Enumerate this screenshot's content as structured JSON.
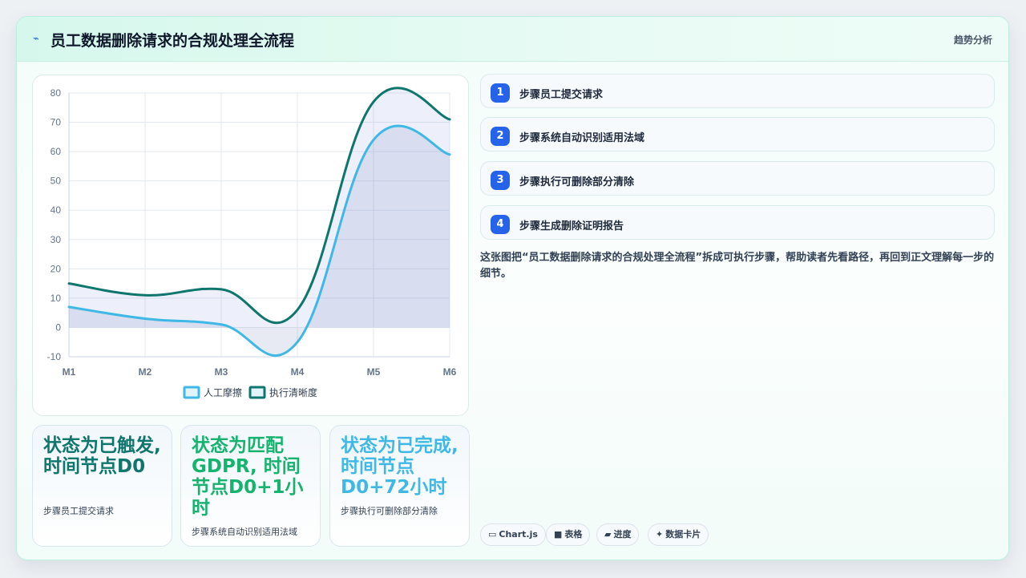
{
  "header": {
    "icon": "bolt-icon",
    "title": "员工数据删除请求的合规处理全流程",
    "tag": "趋势分析"
  },
  "chart_data": {
    "type": "area",
    "categories": [
      "M1",
      "M2",
      "M3",
      "M4",
      "M5",
      "M6"
    ],
    "ylim": [
      -10,
      80
    ],
    "yticks": [
      -10,
      0,
      10,
      20,
      30,
      40,
      50,
      60,
      70,
      80
    ],
    "grid": true,
    "legend_position": "bottom",
    "series": [
      {
        "name": "人工摩擦",
        "values": [
          7,
          3,
          1,
          -5,
          64,
          59
        ],
        "color": "#3fb8e6"
      },
      {
        "name": "执行清晰度",
        "values": [
          15,
          11,
          13,
          6,
          77,
          71
        ],
        "color": "#0f766e"
      }
    ]
  },
  "cards": [
    {
      "value": "状态为已触发, 时间节点D0",
      "label": "步骤员工提交请求",
      "color": "#0f766e"
    },
    {
      "value": "状态为匹配GDPR, 时间节点D0+1小时",
      "label": "步骤系统自动识别适用法域",
      "color": "#16b36e"
    },
    {
      "value": "状态为已完成, 时间节点D0+72小时",
      "label": "步骤执行可删除部分清除",
      "color": "#3fb8e6"
    }
  ],
  "steps": [
    {
      "num": "1",
      "label": "步骤员工提交请求"
    },
    {
      "num": "2",
      "label": "步骤系统自动识别适用法域"
    },
    {
      "num": "3",
      "label": "步骤执行可删除部分清除"
    },
    {
      "num": "4",
      "label": "步骤生成删除证明报告"
    }
  ],
  "description": "这张图把“员工数据删除请求的合规处理全流程”拆成可执行步骤，帮助读者先看路径，再回到正文理解每一步的细节。",
  "chips": [
    {
      "icon": "chart-icon",
      "label": "Chart.js"
    },
    {
      "icon": "table-icon",
      "label": "表格"
    },
    {
      "icon": "progress-icon",
      "label": "进度"
    },
    {
      "icon": "sparkle-icon",
      "label": "数据卡片"
    }
  ]
}
